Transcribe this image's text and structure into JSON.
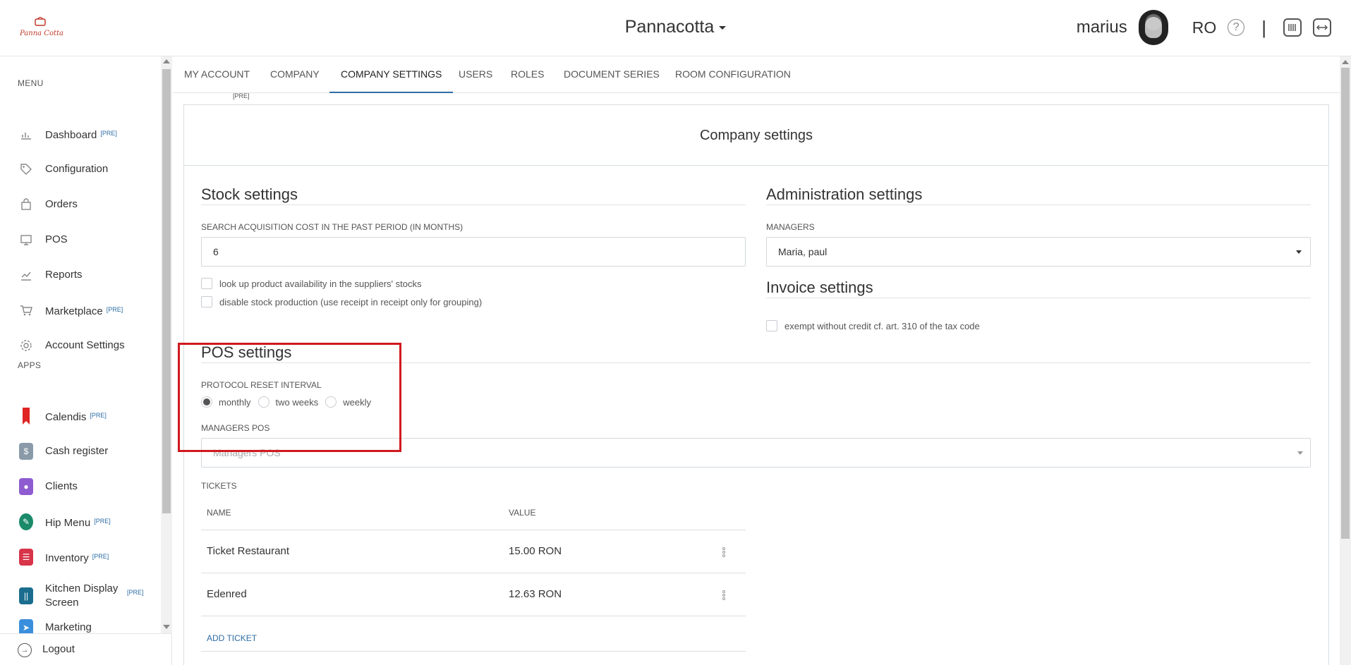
{
  "header": {
    "company": "Pannacotta",
    "username": "marius",
    "language": "RO",
    "help_glyph": "?",
    "separator": "|",
    "logo_text": "Panna Cotta"
  },
  "sidebar": {
    "menu_label": "MENU",
    "apps_label": "APPS",
    "menu_items": [
      {
        "label": "Dashboard",
        "badge": "[PRE]",
        "icon": "bar-chart-icon"
      },
      {
        "label": "Configuration",
        "badge": "",
        "icon": "tag-icon"
      },
      {
        "label": "Orders",
        "badge": "",
        "icon": "shopping-bag-icon"
      },
      {
        "label": "POS",
        "badge": "",
        "icon": "monitor-icon"
      },
      {
        "label": "Reports",
        "badge": "",
        "icon": "line-chart-icon"
      },
      {
        "label": "Marketplace",
        "badge": "[PRE]",
        "icon": "cart-icon"
      },
      {
        "label": "Account Settings",
        "badge": "",
        "icon": "gear-icon"
      }
    ],
    "apps": [
      {
        "label": "Calendis",
        "badge": "[PRE]",
        "color": "#e02424"
      },
      {
        "label": "Cash register",
        "badge": "",
        "color": "#8a9aa8"
      },
      {
        "label": "Clients",
        "badge": "",
        "color": "#8e5bd0"
      },
      {
        "label": "Hip Menu",
        "badge": "[PRE]",
        "color": "#1a8a6a"
      },
      {
        "label": "Inventory",
        "badge": "[PRE]",
        "color": "#d8344a"
      },
      {
        "label": "Kitchen Display Screen",
        "badge": "[PRE]",
        "color": "#1b6d8e"
      },
      {
        "label": "Marketing",
        "badge": "",
        "color": "#3a8fdc"
      }
    ],
    "logout": "Logout"
  },
  "tabs": [
    "MY ACCOUNT",
    "COMPANY",
    "COMPANY SETTINGS",
    "USERS",
    "ROLES",
    "DOCUMENT SERIES",
    "ROOM CONFIGURATION"
  ],
  "active_tab": "COMPANY SETTINGS",
  "tab_badge": "[PRE]",
  "page": {
    "title": "Company settings",
    "stock": {
      "heading": "Stock settings",
      "search_label": "SEARCH ACQUISITION COST IN THE PAST PERIOD (IN MONTHS)",
      "search_value": "6",
      "check1": "look up product availability in the suppliers' stocks",
      "check2": "disable stock production (use receipt in receipt only for grouping)"
    },
    "admin": {
      "heading": "Administration settings",
      "managers_label": "MANAGERS",
      "managers_value": "Maria, paul"
    },
    "invoice": {
      "heading": "Invoice settings",
      "exempt_label": "exempt without credit cf. art. 310 of the tax code"
    },
    "pos": {
      "heading": "POS settings",
      "reset_label": "PROTOCOL RESET INTERVAL",
      "options": [
        "monthly",
        "two weeks",
        "weekly"
      ],
      "selected": "monthly",
      "managers_pos_label": "MANAGERS POS",
      "managers_pos_placeholder": "Managers POS"
    },
    "tickets": {
      "label": "TICKETS",
      "col_name": "NAME",
      "col_value": "VALUE",
      "rows": [
        {
          "name": "Ticket Restaurant",
          "value": "15.00 RON"
        },
        {
          "name": "Edenred",
          "value": "12.63 RON"
        }
      ],
      "add_label": "ADD TICKET"
    }
  },
  "colors": {
    "accent": "#2e6da4",
    "highlight": "#d0191f"
  }
}
